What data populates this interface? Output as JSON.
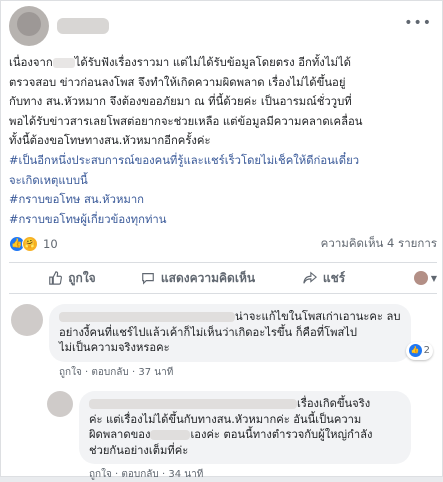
{
  "post": {
    "text_lines": [
      {
        "before": "เนื่องจาก",
        "after": "ได้รับฟังเรื่องราวมา แต่ไม่ได้รับข้อมูลโดยตรง อีกทั้งไม่ได้"
      },
      {
        "before": "ตรวจสอบ ข่าวก่อนลงโพส จึงทำให้เกิดความผิดพลาด เรื่องไม่ได้ขึ้นอยู่",
        "after": ""
      },
      {
        "before": "กับทาง สน.หัวหมาก จึงต้องขออภัยมา ณ ที่นี้ด้วยค่ะ เป็นอารมณ์ชั่ววูบที่",
        "after": ""
      },
      {
        "before": "พอได้รับข่าวสารเลยโพสต่อยากจะช่วยเหลือ แต่ข้อมูลมีความคลาดเคลื่อน",
        "after": ""
      },
      {
        "before": "ทั้งนี้ต้องขอโทษทางสน.หัวหมากอีกครั้งค่ะ",
        "after": ""
      }
    ],
    "hashtags": [
      "#เป็นอีกหนึ่งประสบการณ์ของคนที่รู้และแชร์เร็วโดยไม่เช็คให้ดีก่อนเดี๋ยว",
      "จะเกิดเหตุแบบนี้",
      "#กราบขอโทษ สน.หัวหมาก",
      "#กราบขอโทษผู้เกี่ยวข้องทุกท่าน"
    ],
    "reaction_count": "10",
    "comments_count": "ความคิดเห็น 4 รายการ"
  },
  "actions": {
    "like": "ถูกใจ",
    "comment": "แสดงความคิดเห็น",
    "share": "แชร์"
  },
  "comments": [
    {
      "lines": [
        "น่าจะแก้ไขในโพสเก่าเอานะคะ ลบ",
        "อย่างงี้คนที่แชร์ไปแล้วเค้าก็ไม่เห็นว่าเกิดอะไรขึ้น ก็คือที่โพสไป",
        "ไม่เป็นความจริงหรอคะ"
      ],
      "like": "ถูกใจ",
      "reply": "ตอบกลับ",
      "time": "37 นาที",
      "reactions": "2"
    },
    {
      "lines": [
        "เรื่องเกิดขึ้นจริง",
        "ค่ะ แต่เรื่องไม่ได้ขึ้นกับทางสน.หัวหมากค่ะ อันนี้เป็นความ",
        "ผิดพลาดของ",
        "เองค่ะ ตอนนี้ทางตำรวจกับผู้ใหญ่กำลัง",
        "ช่วยกันอย่างเต็มที่ค่ะ"
      ],
      "like": "ถูกใจ",
      "reply": "ตอบกลับ",
      "time": "34 นาที"
    }
  ],
  "colors": {
    "link": "#385898",
    "like_blue": "#2078f4",
    "bubble": "#f2f3f5"
  },
  "icons": [
    "more-icon",
    "like-reaction-icon",
    "care-reaction-icon",
    "thumbs-up-icon",
    "comment-icon",
    "share-icon",
    "chevron-down-icon"
  ]
}
